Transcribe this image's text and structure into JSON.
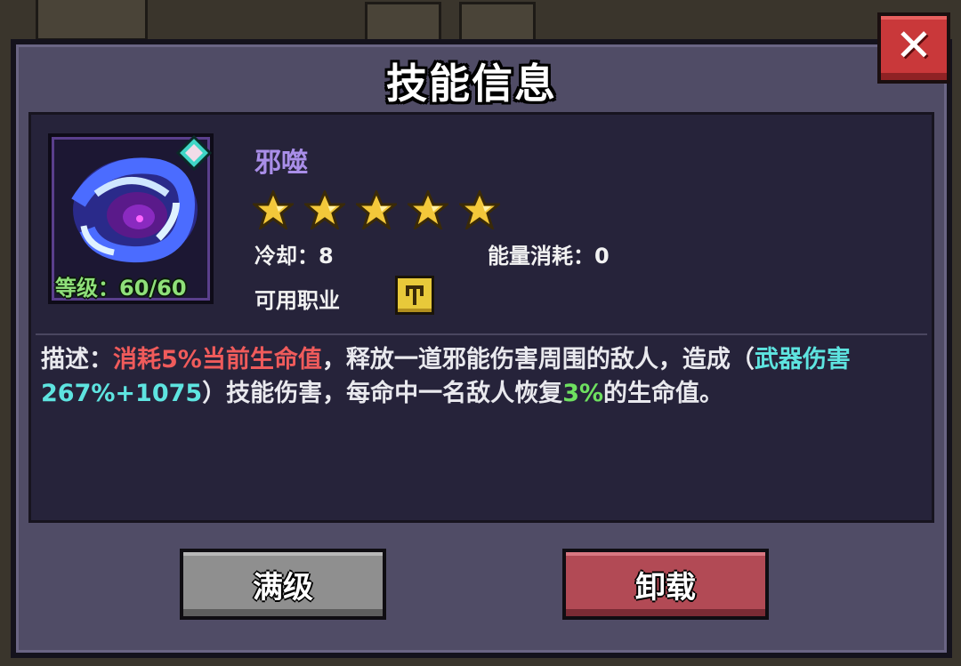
{
  "dialog": {
    "title": "技能信息",
    "close_label": "✕"
  },
  "skill": {
    "name": "邪噬",
    "level_label": "等级：60/60",
    "stars": 5,
    "cooldown_label": "冷却：8",
    "energy_label": "能量消耗：0",
    "classes_label": "可用职业",
    "icon": "dark-vortex-skill-icon",
    "class_icon": "fist-class-icon"
  },
  "description": {
    "prefix": "描述：",
    "cost": "消耗5%当前生命值",
    "mid1": "，释放一道邪能伤害周围的敌人，造成（",
    "damage": "武器伤害267%+1075",
    "mid2": "）技能伤害，每命中一名敌人恢复",
    "heal": "3%",
    "suffix": "的生命值。"
  },
  "buttons": {
    "max_level": "满级",
    "unload": "卸载"
  },
  "colors": {
    "panel": "#504c66",
    "inner": "#26233a",
    "cost_red": "#f05b5b",
    "damage_cyan": "#5ee4e0",
    "heal_green": "#6ee060",
    "close_red": "#c9383a"
  }
}
